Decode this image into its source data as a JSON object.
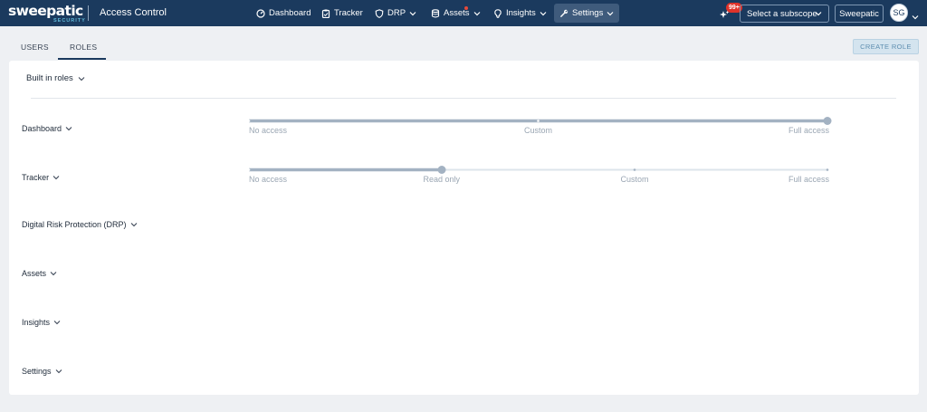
{
  "header": {
    "logo_text": "sweepatic",
    "logo_subtext": "SECURITY",
    "app_title": "Access Control",
    "nav": [
      {
        "label": "Dashboard",
        "icon": "dashboard-icon",
        "chevron": false
      },
      {
        "label": "Tracker",
        "icon": "clipboard-icon",
        "chevron": false
      },
      {
        "label": "DRP",
        "icon": "shield-icon",
        "chevron": true
      },
      {
        "label": "Assets",
        "icon": "database-icon",
        "chevron": true,
        "dot": true
      },
      {
        "label": "Insights",
        "icon": "lightbulb-icon",
        "chevron": true
      },
      {
        "label": "Settings",
        "icon": "wrench-icon",
        "chevron": true,
        "active": true
      }
    ],
    "notifications_badge": "99+",
    "subscope_label": "Select a subscope",
    "org_label": "Sweepatic",
    "avatar_initials": "SG"
  },
  "tabs": [
    {
      "label": "USERS",
      "active": false
    },
    {
      "label": "ROLES",
      "active": true
    }
  ],
  "create_role_label": "CREATE ROLE",
  "roles_dropdown_label": "Built in roles",
  "permissions": [
    {
      "label": "Dashboard",
      "levels": [
        "No access",
        "Custom",
        "Full access"
      ],
      "selected": 2
    },
    {
      "label": "Tracker",
      "levels": [
        "No access",
        "Read only",
        "Custom",
        "Full access"
      ],
      "selected": 1
    },
    {
      "label": "Digital Risk Protection (DRP)"
    },
    {
      "label": "Assets"
    },
    {
      "label": "Insights"
    },
    {
      "label": "Settings"
    }
  ],
  "colors": {
    "header_bg": "#1b3a5e",
    "slider_active": "#a3b2c2",
    "slider_inactive": "#dde4eb",
    "badge_red": "#e0332a"
  }
}
